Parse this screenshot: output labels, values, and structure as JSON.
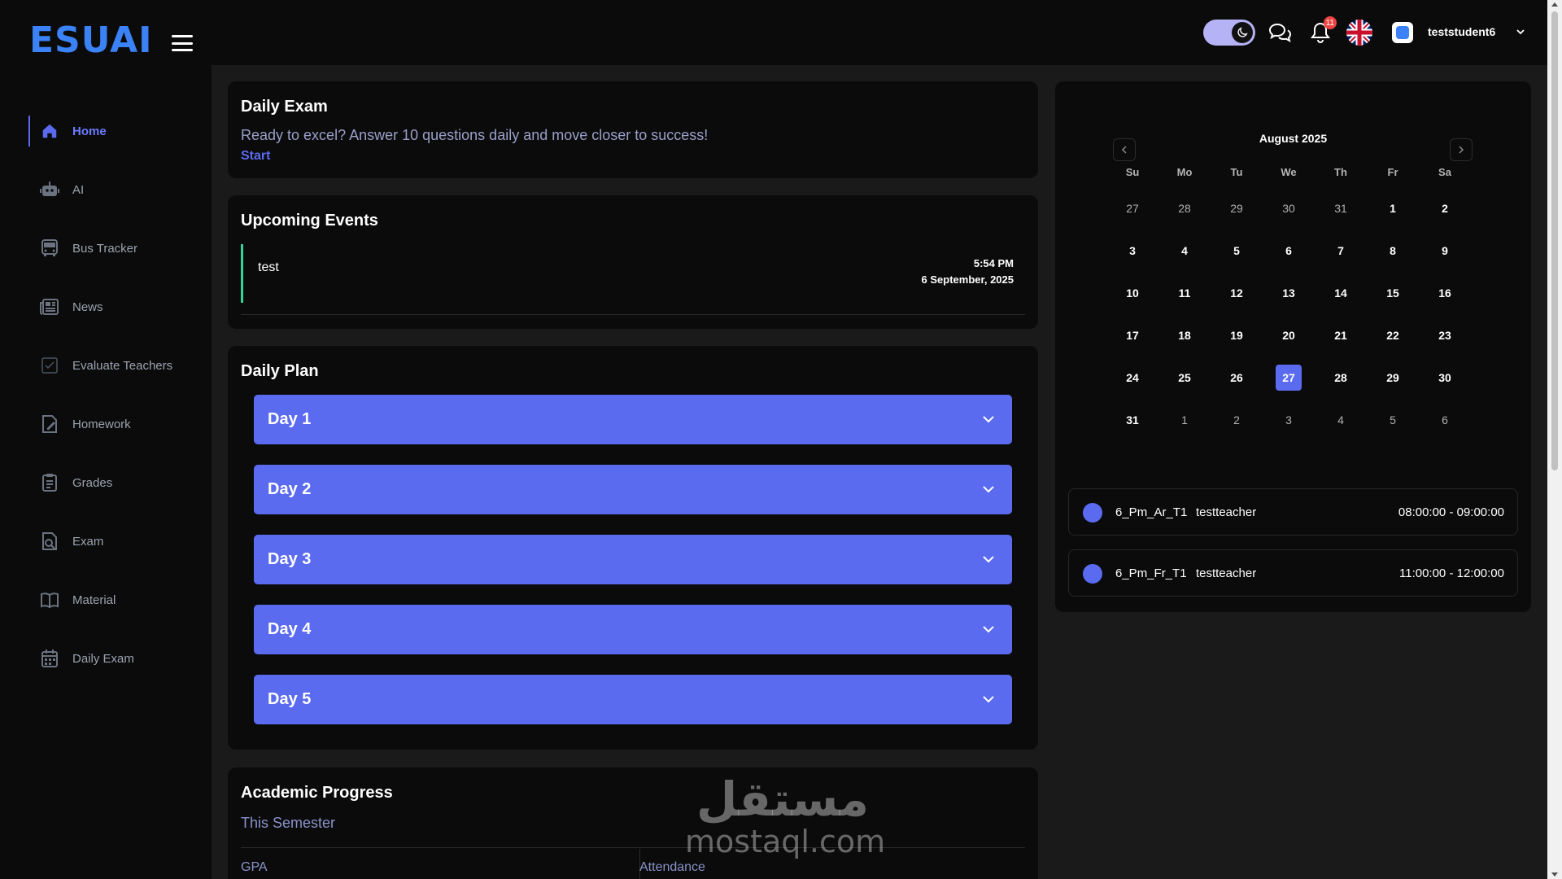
{
  "header": {
    "logo_text": "ESUAI",
    "username": "teststudent6",
    "notification_count": "11",
    "theme": "dark"
  },
  "sidebar": {
    "items": [
      {
        "label": "Home",
        "icon": "home-icon",
        "active": true
      },
      {
        "label": "AI",
        "icon": "robot-icon",
        "active": false
      },
      {
        "label": "Bus Tracker",
        "icon": "bus-icon",
        "active": false
      },
      {
        "label": "News",
        "icon": "newspaper-icon",
        "active": false
      },
      {
        "label": "Evaluate Teachers",
        "icon": "checkbox-icon",
        "active": false
      },
      {
        "label": "Homework",
        "icon": "homework-icon",
        "active": false
      },
      {
        "label": "Grades",
        "icon": "clipboard-icon",
        "active": false
      },
      {
        "label": "Exam",
        "icon": "exam-icon",
        "active": false
      },
      {
        "label": "Material",
        "icon": "book-icon",
        "active": false
      },
      {
        "label": "Daily Exam",
        "icon": "calendar-icon",
        "active": false
      }
    ]
  },
  "daily_exam": {
    "title": "Daily Exam",
    "text": "Ready to excel? Answer 10 questions daily and move closer to success!",
    "start_label": "Start"
  },
  "upcoming_events": {
    "title": "Upcoming Events",
    "events": [
      {
        "name": "test",
        "time": "5:54 PM",
        "date": "6 September, 2025"
      }
    ]
  },
  "daily_plan": {
    "title": "Daily Plan",
    "days": [
      "Day 1",
      "Day 2",
      "Day 3",
      "Day 4",
      "Day 5"
    ]
  },
  "academic_progress": {
    "title": "Academic Progress",
    "subtitle": "This Semester",
    "gpa_label": "GPA",
    "attendance_label": "Attendance"
  },
  "watermark": {
    "arabic": "مستقل",
    "latin": "mostaql.com"
  },
  "calendar": {
    "month_label": "August 2025",
    "weekdays": [
      "Su",
      "Mo",
      "Tu",
      "We",
      "Th",
      "Fr",
      "Sa"
    ],
    "weeks": [
      [
        {
          "d": "27",
          "m": true
        },
        {
          "d": "28",
          "m": true
        },
        {
          "d": "29",
          "m": true
        },
        {
          "d": "30",
          "m": true
        },
        {
          "d": "31",
          "m": true
        },
        {
          "d": "1"
        },
        {
          "d": "2"
        }
      ],
      [
        {
          "d": "3"
        },
        {
          "d": "4"
        },
        {
          "d": "5"
        },
        {
          "d": "6"
        },
        {
          "d": "7"
        },
        {
          "d": "8"
        },
        {
          "d": "9"
        }
      ],
      [
        {
          "d": "10"
        },
        {
          "d": "11"
        },
        {
          "d": "12"
        },
        {
          "d": "13"
        },
        {
          "d": "14"
        },
        {
          "d": "15"
        },
        {
          "d": "16"
        }
      ],
      [
        {
          "d": "17"
        },
        {
          "d": "18"
        },
        {
          "d": "19"
        },
        {
          "d": "20"
        },
        {
          "d": "21"
        },
        {
          "d": "22"
        },
        {
          "d": "23"
        }
      ],
      [
        {
          "d": "24"
        },
        {
          "d": "25"
        },
        {
          "d": "26"
        },
        {
          "d": "27",
          "today": true
        },
        {
          "d": "28"
        },
        {
          "d": "29"
        },
        {
          "d": "30"
        }
      ],
      [
        {
          "d": "31"
        },
        {
          "d": "1",
          "m": true
        },
        {
          "d": "2",
          "m": true
        },
        {
          "d": "3",
          "m": true
        },
        {
          "d": "4",
          "m": true
        },
        {
          "d": "5",
          "m": true
        },
        {
          "d": "6",
          "m": true
        }
      ]
    ]
  },
  "schedule": [
    {
      "code": "6_Pm_Ar_T1",
      "teacher": "testteacher",
      "time": "08:00:00 - 09:00:00"
    },
    {
      "code": "6_Pm_Fr_T1",
      "teacher": "testteacher",
      "time": "11:00:00 - 12:00:00"
    }
  ],
  "colors": {
    "accent": "#5b6bf0",
    "background": "#1a1a1a",
    "card": "#0b0b0b",
    "event_bar": "#34d399"
  }
}
